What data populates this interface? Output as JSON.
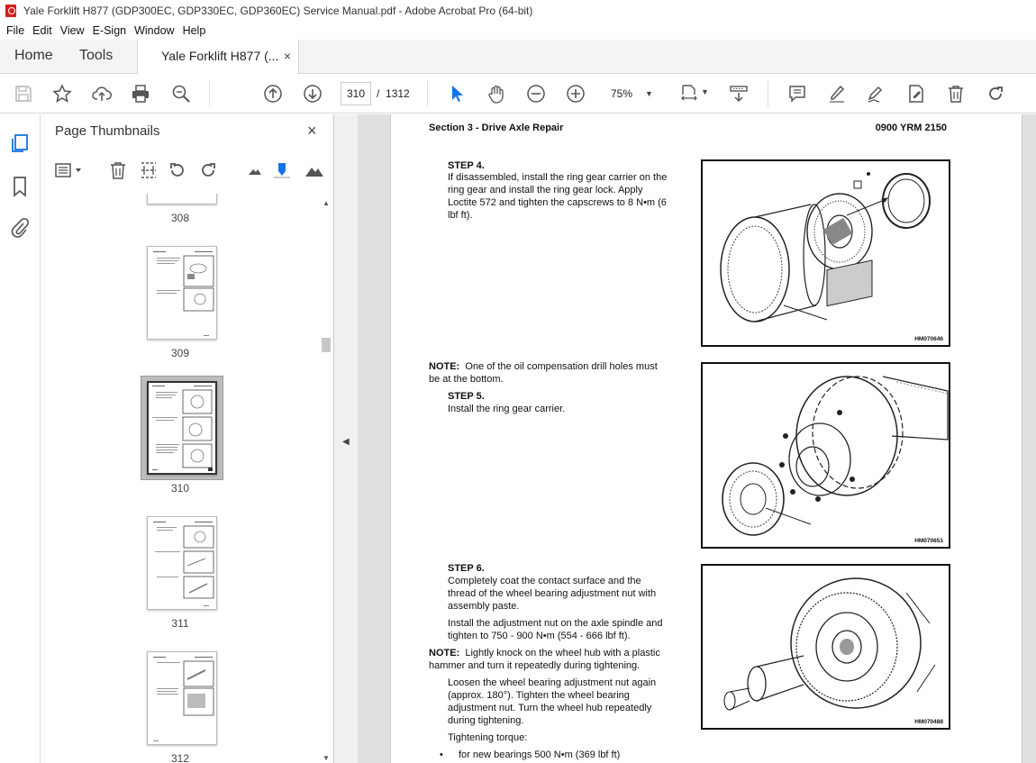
{
  "window": {
    "title": "Yale Forklift H877 (GDP300EC, GDP330EC, GDP360EC) Service Manual.pdf - Adobe Acrobat Pro (64-bit)"
  },
  "menu": [
    "File",
    "Edit",
    "View",
    "E-Sign",
    "Window",
    "Help"
  ],
  "tabs": {
    "home": "Home",
    "tools": "Tools",
    "document": "Yale Forklift H877 (...",
    "close": "×"
  },
  "toolbar": {
    "page_current": "310",
    "page_sep": "/",
    "page_total": "1312",
    "zoom": "75%"
  },
  "panel": {
    "title": "Page Thumbnails",
    "close": "×"
  },
  "thumbnails": [
    {
      "label": "308"
    },
    {
      "label": "309"
    },
    {
      "label": "310"
    },
    {
      "label": "311"
    },
    {
      "label": "312"
    }
  ],
  "page": {
    "section_title": "Section 3 - Drive Axle Repair",
    "doc_code": "0900 YRM 2150",
    "step4_title": "STEP 4.",
    "step4_lines": [
      "If disassembled, install the ring gear carrier on the",
      "ring gear and install the ring gear lock. Apply",
      "Loctite 572 and tighten the capscrews to 8 N•m (6",
      "lbf ft)."
    ],
    "note1_label": "NOTE:",
    "note1_lines": [
      "One of the oil compensation drill holes must",
      "be at the bottom."
    ],
    "step5_title": "STEP 5.",
    "step5_text": "Install the ring gear carrier.",
    "step6_title": "STEP 6.",
    "step6_lines": [
      "Completely coat the contact surface and the",
      "thread of the wheel bearing adjustment nut with",
      "assembly paste."
    ],
    "step6b_lines": [
      "Install the adjustment nut on the axle spindle and",
      "tighten to 750 - 900 N•m (554 - 666 lbf ft)."
    ],
    "note2_label": "NOTE:",
    "note2_lines": [
      "Lightly knock on the wheel hub with a plastic",
      "hammer and turn it repeatedly during tightening."
    ],
    "loosen_lines": [
      "Loosen the wheel bearing adjustment nut again",
      "(approx. 180°). Tighten the wheel bearing",
      "adjustment nut. Turn the wheel hub repeatedly",
      "during tightening."
    ],
    "torque_label": "Tightening torque:",
    "bullet1": "for new bearings 500 N•m (369 lbf ft)",
    "fig1_code": "HM070646",
    "fig2_code": "HM070651",
    "fig3_code": "HM070488"
  }
}
